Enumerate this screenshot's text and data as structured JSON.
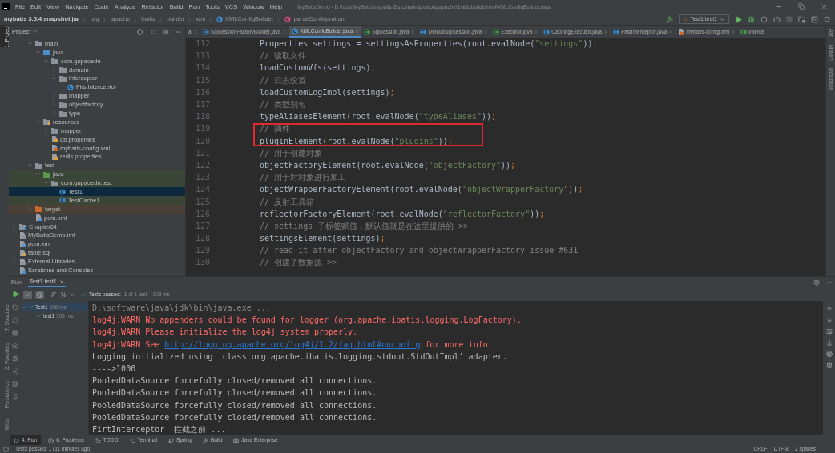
{
  "window": {
    "menu": [
      "File",
      "Edit",
      "View",
      "Navigate",
      "Code",
      "Analyze",
      "Refactor",
      "Build",
      "Run",
      "Tools",
      "VCS",
      "Window",
      "Help"
    ],
    "title": "MyBatisDemo - D:\\tools\\MyBatis\\mybatis-3\\src\\main\\java\\org\\apache\\ibatis\\builder\\xml\\XMLConfigBuilder.java"
  },
  "navbar": {
    "breadcrumbs": [
      {
        "label": "mybatis 3.5.4 snapshot.jar",
        "kind": "jar"
      },
      {
        "label": "org",
        "kind": "package"
      },
      {
        "label": "apache",
        "kind": "package"
      },
      {
        "label": "ibatis",
        "kind": "package"
      },
      {
        "label": "builder",
        "kind": "package"
      },
      {
        "label": "xml",
        "kind": "package"
      },
      {
        "label": "XMLConfigBuilder",
        "kind": "class"
      },
      {
        "label": "parseConfiguration",
        "kind": "method"
      }
    ],
    "run_config": "Test1.test1"
  },
  "left_stripe": {
    "top": [
      {
        "label": "1: Project",
        "selected": true
      }
    ],
    "bottom": [
      {
        "label": "7: Structure",
        "selected": false
      },
      {
        "label": "2: Favorites",
        "selected": false
      },
      {
        "label": "Persistence",
        "selected": false
      },
      {
        "label": "Web",
        "selected": false
      }
    ]
  },
  "right_stripe": [
    {
      "label": "Ant"
    },
    {
      "label": "Maven"
    },
    {
      "label": "Database"
    }
  ],
  "project": {
    "title": "Project",
    "tree": [
      {
        "children": [
          {
            "children": [
              {
                "label": "main",
                "kind": "folder",
                "expanded": true,
                "selected": false,
                "children": [
                  {
                    "label": "java",
                    "kind": "source-folder",
                    "expanded": true,
                    "selected": false,
                    "children": [
                      {
                        "label": "com.gupaoedu",
                        "kind": "package",
                        "expanded": true,
                        "selected": false,
                        "children": [
                          {
                            "label": "domain",
                            "kind": "package",
                            "expanded": false,
                            "selected": false
                          },
                          {
                            "label": "interceptor",
                            "kind": "package",
                            "expanded": true,
                            "selected": false,
                            "children": [
                              {
                                "label": "FirstInterceptor",
                                "kind": "class",
                                "selected": false
                              }
                            ]
                          },
                          {
                            "label": "mapper",
                            "kind": "package",
                            "expanded": false,
                            "selected": false
                          },
                          {
                            "label": "objectfactory",
                            "kind": "package",
                            "expanded": false,
                            "selected": false
                          },
                          {
                            "label": "type",
                            "kind": "package",
                            "expanded": false,
                            "selected": false
                          }
                        ]
                      }
                    ]
                  },
                  {
                    "label": "resources",
                    "kind": "resources-folder",
                    "expanded": true,
                    "selected": false,
                    "children": [
                      {
                        "label": "mapper",
                        "kind": "folder",
                        "expanded": false,
                        "selected": false
                      },
                      {
                        "label": "db.properties",
                        "kind": "properties",
                        "selected": false
                      },
                      {
                        "label": "mybatis-config.xml",
                        "kind": "xml",
                        "selected": false
                      },
                      {
                        "label": "redis.properties",
                        "kind": "properties",
                        "selected": false
                      }
                    ]
                  }
                ]
              },
              {
                "label": "test",
                "kind": "folder",
                "expanded": true,
                "selected": false,
                "children": [
                  {
                    "label": "java",
                    "kind": "test-folder",
                    "expanded": true,
                    "selected": false,
                    "children": [
                      {
                        "label": "com.gupaoedu.test",
                        "kind": "package",
                        "expanded": true,
                        "selected": false,
                        "children": [
                          {
                            "label": "Test1",
                            "kind": "test-class",
                            "selected": true
                          },
                          {
                            "label": "TestCache1",
                            "kind": "test-class",
                            "selected": false
                          }
                        ]
                      }
                    ]
                  }
                ]
              },
              {
                "label": "target",
                "kind": "excluded-folder",
                "expanded": false,
                "selected": false
              },
              {
                "label": "pom.xml",
                "kind": "maven",
                "selected": false
              }
            ]
          }
        ]
      },
      {
        "label": "Chapter04",
        "kind": "module",
        "expanded": false,
        "selected": false
      },
      {
        "label": "MyBatisDemo.iml",
        "kind": "iml",
        "selected": false
      },
      {
        "label": "pom.xml",
        "kind": "maven",
        "selected": false
      },
      {
        "label": "table.sql",
        "kind": "sql",
        "selected": false
      },
      {
        "label": "External Libraries",
        "kind": "libraries",
        "expanded": false,
        "selected": false
      },
      {
        "label": "Scratches and Consoles",
        "kind": "scratches",
        "selected": false
      }
    ]
  },
  "editor": {
    "tabs": [
      {
        "label": "a",
        "selected": false
      },
      {
        "label": "SqlSessionFactoryBuilder.java",
        "kind": "class",
        "selected": false
      },
      {
        "label": "XMLConfigBuilder.java",
        "kind": "class",
        "selected": true
      },
      {
        "label": "SqlSession.java",
        "kind": "interface",
        "selected": false
      },
      {
        "label": "DefaultSqlSession.java",
        "kind": "class",
        "selected": false
      },
      {
        "label": "Executor.java",
        "kind": "interface",
        "selected": false
      },
      {
        "label": "CachingExecutor.java",
        "kind": "class",
        "selected": false
      },
      {
        "label": "FirstInterceptor.java",
        "kind": "class",
        "selected": false
      },
      {
        "label": "mybatis-config.xml",
        "kind": "xml",
        "selected": false
      },
      {
        "label": "Interce",
        "kind": "interface",
        "selected": false
      }
    ],
    "lines": [
      {
        "number": "112",
        "kind": "code",
        "text": "Properties settings = settingsAsProperties(root.evalNode(\"settings\"));",
        "boxed": false
      },
      {
        "number": "113",
        "kind": "comment",
        "text": "// 读取文件",
        "boxed": false
      },
      {
        "number": "114",
        "kind": "code",
        "text": "loadCustomVfs(settings);",
        "boxed": false
      },
      {
        "number": "115",
        "kind": "comment",
        "text": "// 日志设置",
        "boxed": false
      },
      {
        "number": "116",
        "kind": "code",
        "text": "loadCustomLogImpl(settings);",
        "boxed": false
      },
      {
        "number": "117",
        "kind": "comment",
        "text": "// 类型别名",
        "boxed": false
      },
      {
        "number": "118",
        "kind": "code",
        "text": "typeAliasesElement(root.evalNode(\"typeAliases\"));",
        "boxed": false
      },
      {
        "number": "119",
        "kind": "comment",
        "text": "// 插件",
        "boxed": true
      },
      {
        "number": "120",
        "kind": "code",
        "text": "pluginElement(root.evalNode(\"plugins\"));",
        "boxed": true
      },
      {
        "number": "121",
        "kind": "comment",
        "text": "// 用于创建对象",
        "boxed": false
      },
      {
        "number": "122",
        "kind": "code",
        "text": "objectFactoryElement(root.evalNode(\"objectFactory\"));",
        "boxed": false
      },
      {
        "number": "123",
        "kind": "comment",
        "text": "// 用于对对象进行加工",
        "boxed": false
      },
      {
        "number": "124",
        "kind": "code",
        "text": "objectWrapperFactoryElement(root.evalNode(\"objectWrapperFactory\"));",
        "boxed": false
      },
      {
        "number": "125",
        "kind": "comment",
        "text": "// 反射工具箱",
        "boxed": false
      },
      {
        "number": "126",
        "kind": "code",
        "text": "reflectorFactoryElement(root.evalNode(\"reflectorFactory\"));",
        "boxed": false
      },
      {
        "number": "127",
        "kind": "comment",
        "text": "// settings 子标签赋值，默认值就是在这里提供的 >>",
        "boxed": false
      },
      {
        "number": "128",
        "kind": "code",
        "text": "settingsElement(settings);",
        "boxed": false
      },
      {
        "number": "129",
        "kind": "comment",
        "text": "// read it after objectFactory and objectWrapperFactory issue #631",
        "boxed": false
      },
      {
        "number": "130",
        "kind": "comment",
        "text": "// 创建了数据源 >>",
        "boxed": false
      }
    ]
  },
  "run": {
    "label": "Run:",
    "tab": "Test1.test1",
    "toggles": [
      {
        "kind": "show-passed",
        "on": true
      },
      {
        "kind": "show-ignored",
        "on": true
      }
    ],
    "status_label": "Tests passed:",
    "status_detail": "1 of 1 test – 308 ms",
    "tests": [
      {
        "label": "Test1",
        "duration": "308 ms",
        "selected": true,
        "expanded": true,
        "children": [
          {
            "label": "test1",
            "duration": "308 ms",
            "selected": false
          }
        ]
      }
    ],
    "console": [
      {
        "kind": "command",
        "text": "D:\\software\\java\\jdk\\bin\\java.exe ..."
      },
      {
        "kind": "warn",
        "text": "log4j:WARN No appenders could be found for logger (org.apache.ibatis.logging.LogFactory)."
      },
      {
        "kind": "warn",
        "text": "log4j:WARN Please initialize the log4j system properly."
      },
      {
        "kind": "warn-link",
        "text": "log4j:WARN See ",
        "link": "http://logging.apache.org/log4j/1.2/faq.html#noconfig",
        "after": " for more info."
      },
      {
        "kind": "info",
        "text": "Logging initialized using 'class org.apache.ibatis.logging.stdout.StdOutImpl' adapter."
      },
      {
        "kind": "info",
        "text": "---->1000"
      },
      {
        "kind": "info",
        "text": "PooledDataSource forcefully closed/removed all connections."
      },
      {
        "kind": "info",
        "text": "PooledDataSource forcefully closed/removed all connections."
      },
      {
        "kind": "info",
        "text": "PooledDataSource forcefully closed/removed all connections."
      },
      {
        "kind": "info",
        "text": "PooledDataSource forcefully closed/removed all connections."
      },
      {
        "kind": "info",
        "text": "FirtInterceptor  拦截之前 ...."
      }
    ]
  },
  "tool_windows": [
    {
      "label": "4: Run",
      "kind": "run",
      "selected": true
    },
    {
      "label": "6: Problems",
      "kind": "problems",
      "selected": false
    },
    {
      "label": "TODO",
      "kind": "todo",
      "selected": false
    },
    {
      "label": "Terminal",
      "kind": "terminal",
      "selected": false
    },
    {
      "label": "Spring",
      "kind": "spring",
      "selected": false
    },
    {
      "label": "Build",
      "kind": "build",
      "selected": false
    },
    {
      "label": "Java Enterprise",
      "kind": "enterprise",
      "selected": false
    }
  ],
  "status_bar": {
    "message": "Tests passed: 1 (11 minutes ago)",
    "items": [
      "CRLF",
      "UTF-8",
      "2 spaces"
    ]
  }
}
